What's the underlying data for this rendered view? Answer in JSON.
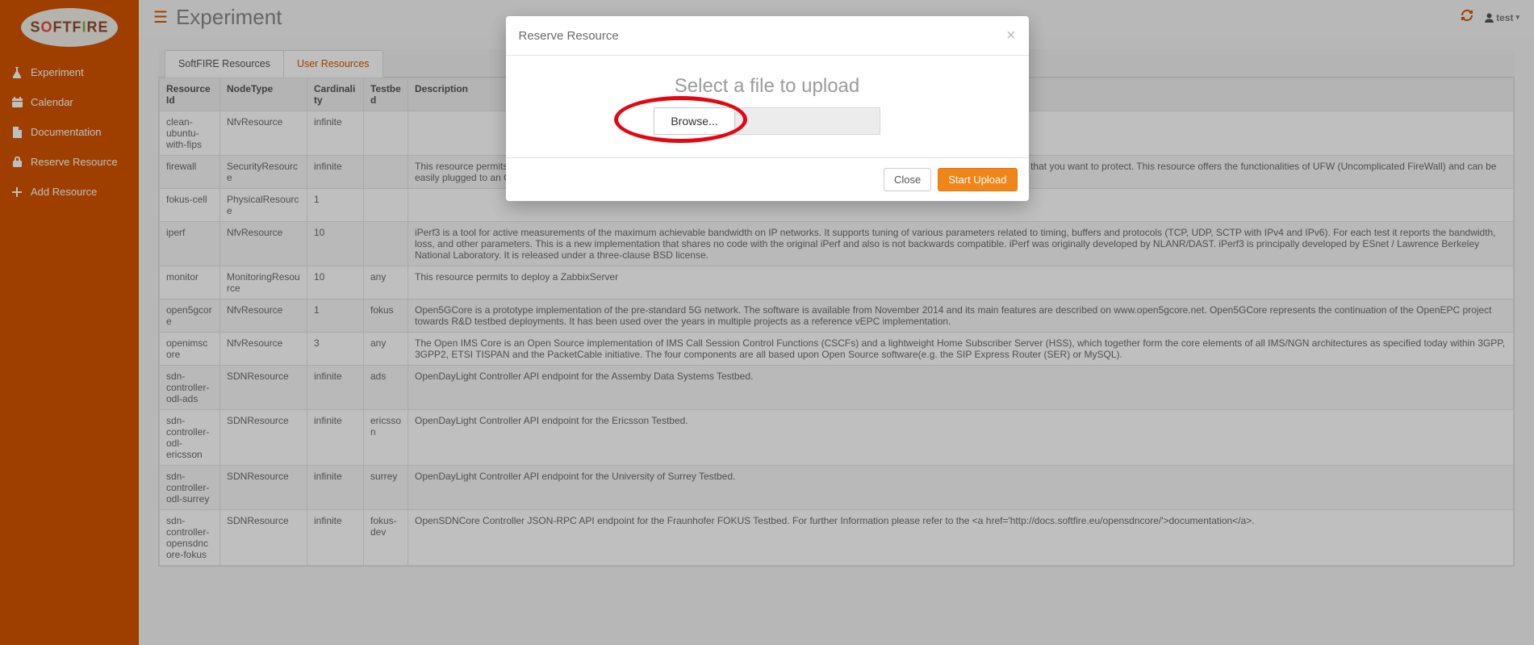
{
  "brand": "SOFTFIRE",
  "page_title": "Experiment",
  "user_label": "test",
  "sidebar": {
    "items": [
      {
        "icon": "flask",
        "label": "Experiment"
      },
      {
        "icon": "calendar",
        "label": "Calendar"
      },
      {
        "icon": "doc",
        "label": "Documentation"
      },
      {
        "icon": "lock",
        "label": "Reserve Resource"
      },
      {
        "icon": "plus",
        "label": "Add Resource"
      }
    ]
  },
  "tabs": [
    {
      "label": "SoftFIRE Resources",
      "active": false
    },
    {
      "label": "User Resources",
      "active": true
    }
  ],
  "columns": [
    "Resource Id",
    "NodeType",
    "Cardinality",
    "Testbed",
    "Description"
  ],
  "rows": [
    {
      "id": "clean-ubuntu-with-fips",
      "nt": "NfvResource",
      "card": "infinite",
      "tb": "",
      "desc": ""
    },
    {
      "id": "firewall",
      "nt": "SecurityResource",
      "card": "infinite",
      "tb": "",
      "desc": "This resource permits to deploy a firewall. You can deploy it as a standalone VM, or you can use it as an agent directly installed on the machine that you want to protect. This resource offers the functionalities of UFW (Uncomplicated FireWall) and can be easily plugged to an OpenVPN server. More information at http://docs.softfire.eu/security-manager/"
    },
    {
      "id": "fokus-cell",
      "nt": "PhysicalResource",
      "card": "1",
      "tb": "",
      "desc": ""
    },
    {
      "id": "iperf",
      "nt": "NfvResource",
      "card": "10",
      "tb": "",
      "desc": "iPerf3 is a tool for active measurements of the maximum achievable bandwidth on IP networks. It supports tuning of various parameters related to timing, buffers and protocols (TCP, UDP, SCTP with IPv4 and IPv6). For each test it reports the bandwidth, loss, and other parameters. This is a new implementation that shares no code with the original iPerf and also is not backwards compatible. iPerf was originally developed by NLANR/DAST. iPerf3 is principally developed by ESnet / Lawrence Berkeley National Laboratory. It is released under a three-clause BSD license."
    },
    {
      "id": "monitor",
      "nt": "MonitoringResource",
      "card": "10",
      "tb": "any",
      "desc": "This resource permits to deploy a ZabbixServer"
    },
    {
      "id": "open5gcore",
      "nt": "NfvResource",
      "card": "1",
      "tb": "fokus",
      "desc": "Open5GCore is a prototype implementation of the pre-standard 5G network. The software is available from November 2014 and its main features are described on www.open5gcore.net. Open5GCore represents the continuation of the OpenEPC project towards R&D testbed deployments. It has been used over the years in multiple projects as a reference vEPC implementation."
    },
    {
      "id": "openimscore",
      "nt": "NfvResource",
      "card": "3",
      "tb": "any",
      "desc": "The Open IMS Core is an Open Source implementation of IMS Call Session Control Functions (CSCFs) and a lightweight Home Subscriber Server (HSS), which together form the core elements of all IMS/NGN architectures as specified today within 3GPP, 3GPP2, ETSI TISPAN and the PacketCable initiative. The four components are all based upon Open Source software(e.g. the SIP Express Router (SER) or MySQL)."
    },
    {
      "id": "sdn-controller-odl-ads",
      "nt": "SDNResource",
      "card": "infinite",
      "tb": "ads",
      "desc": "OpenDayLight Controller API endpoint for the Assemby Data Systems Testbed."
    },
    {
      "id": "sdn-controller-odl-ericsson",
      "nt": "SDNResource",
      "card": "infinite",
      "tb": "ericsson",
      "desc": "OpenDayLight Controller API endpoint for the Ericsson Testbed."
    },
    {
      "id": "sdn-controller-odl-surrey",
      "nt": "SDNResource",
      "card": "infinite",
      "tb": "surrey",
      "desc": "OpenDayLight Controller API endpoint for the University of Surrey Testbed."
    },
    {
      "id": "sdn-controller-opensdncore-fokus",
      "nt": "SDNResource",
      "card": "infinite",
      "tb": "fokus-dev",
      "desc": "OpenSDNCore Controller JSON-RPC API endpoint for the Fraunhofer FOKUS Testbed. For further Information please refer to the <a href='http://docs.softfire.eu/opensdncore/'>documentation</a>."
    }
  ],
  "modal": {
    "title": "Reserve Resource",
    "heading": "Select a file to upload",
    "browse": "Browse...",
    "close": "Close",
    "start": "Start Upload"
  }
}
